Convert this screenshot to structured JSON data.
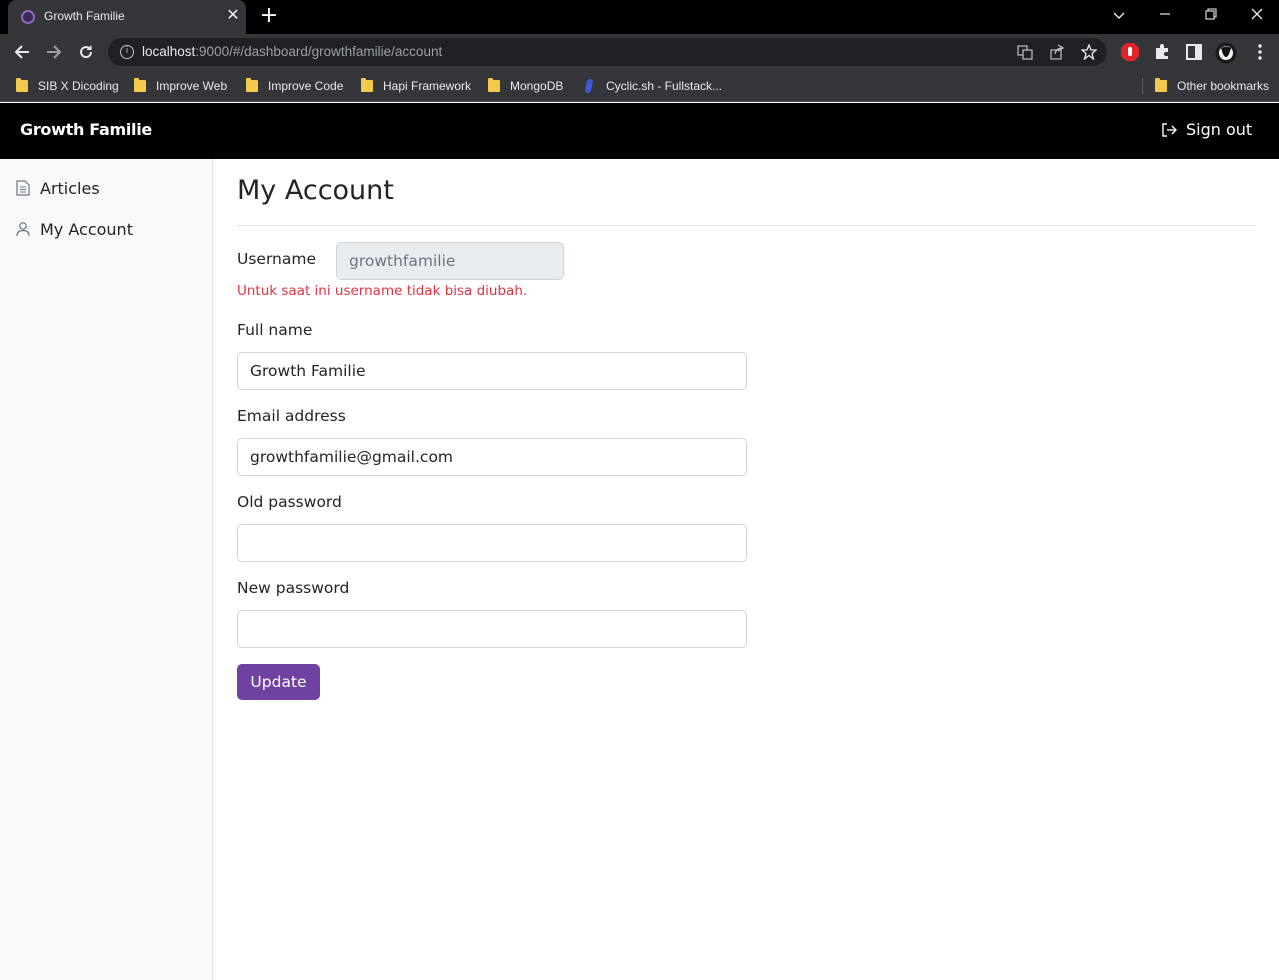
{
  "browser": {
    "tab_title": "Growth Familie",
    "tab_close": "✕",
    "new_tab": "+",
    "url_host": "localhost",
    "url_rest": ":9000/#/dashboard/growthfamilie/account",
    "bookmarks": [
      {
        "label": "SIB X Dicoding",
        "icon": "folder-icon"
      },
      {
        "label": "Improve Web",
        "icon": "folder-icon"
      },
      {
        "label": "Improve Code",
        "icon": "folder-icon"
      },
      {
        "label": "Hapi Framework",
        "icon": "folder-icon"
      },
      {
        "label": "MongoDB",
        "icon": "folder-icon"
      },
      {
        "label": "Cyclic.sh - Fullstack...",
        "icon": "cyclic-icon"
      }
    ],
    "other_bookmarks": "Other bookmarks"
  },
  "app": {
    "brand": "Growth Familie",
    "signout_label": "Sign out"
  },
  "sidebar": {
    "items": [
      {
        "label": "Articles",
        "icon": "file-text-icon"
      },
      {
        "label": "My Account",
        "icon": "person-icon"
      }
    ]
  },
  "account": {
    "title": "My Account",
    "username_label": "Username",
    "username_value": "growthfamilie",
    "username_hint": "Untuk saat ini username tidak bisa diubah.",
    "fullname_label": "Full name",
    "fullname_value": "Growth Familie",
    "email_label": "Email address",
    "email_value": "growthfamilie@gmail.com",
    "old_password_label": "Old password",
    "old_password_value": "",
    "new_password_label": "New password",
    "new_password_value": "",
    "update_button": "Update"
  },
  "colors": {
    "accent": "#6f42a1",
    "error": "#dc3545",
    "appbar": "#000000"
  }
}
